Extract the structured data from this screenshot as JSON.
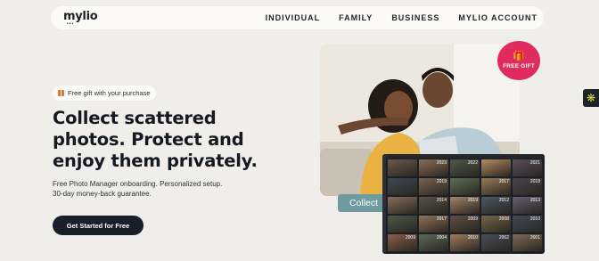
{
  "nav": {
    "logo": "mylio",
    "items": [
      "INDIVIDUAL",
      "FAMILY",
      "BUSINESS",
      "MYLIO ACCOUNT"
    ]
  },
  "hero": {
    "gift_pill": "Free gift with your purchase",
    "headline": "Collect scattered photos. Protect and enjoy them privately.",
    "subtext": "Free Photo Manager onboarding. Personalized setup. 30-day money-back guarantee.",
    "cta": "Get Started for Free"
  },
  "badge": {
    "label": "FREE GIFT",
    "icon": "gift-icon"
  },
  "collect_tag": "Collect",
  "photo_grid": {
    "years": [
      "",
      "2023",
      "2022",
      "",
      "2021",
      "",
      "2019",
      "",
      "2017",
      "2018",
      "",
      "2014",
      "2019",
      "2012",
      "2013",
      "",
      "2017",
      "2009",
      "2008",
      "2010",
      "2009",
      "2004",
      "2010",
      "2002",
      "2001"
    ],
    "tones": [
      "#6b5a4a",
      "#8a6f55",
      "#4f5a48",
      "#b28c62",
      "#5a4e60",
      "#3d4a56",
      "#7a6450",
      "#5f6e52",
      "#9a7a5a",
      "#4c4450",
      "#86705a",
      "#5c5148",
      "#a28566",
      "#4b5a62",
      "#6a5d70",
      "#4d5848",
      "#8f7456",
      "#5a4f44",
      "#76684c",
      "#3f4c58",
      "#8a5e4a",
      "#5d6a58",
      "#a07c5e",
      "#4a4e56",
      "#7d6a54"
    ]
  },
  "widget": {
    "icon": "sparkle-icon"
  },
  "colors": {
    "background": "#efeeea",
    "cta": "#172028",
    "badge": "#e02b5e",
    "collect_tag": "#6f9aa0",
    "gift_icon": "#e0733a"
  }
}
